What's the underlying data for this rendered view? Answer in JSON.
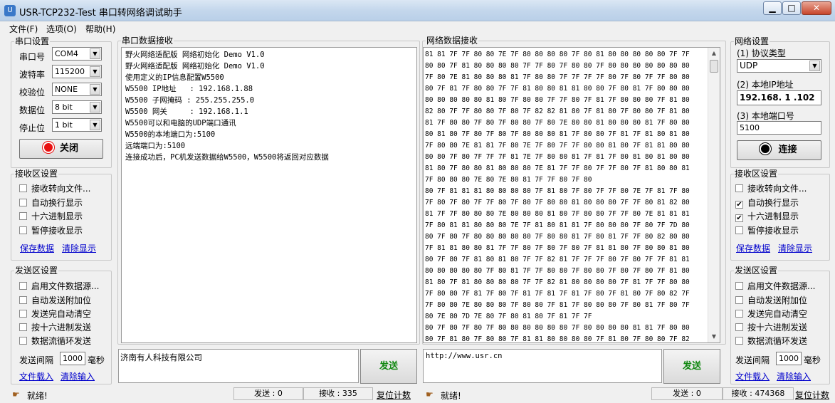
{
  "window": {
    "title": "USR-TCP232-Test 串口转网络调试助手",
    "minimize": "▁",
    "maximize": "□",
    "close": "✕"
  },
  "menu": [
    "文件(F)",
    "选项(O)",
    "帮助(H)"
  ],
  "serial": {
    "group": "串口设置",
    "port_label": "串口号",
    "port_value": "COM4",
    "baud_label": "波特率",
    "baud_value": "115200",
    "parity_label": "校验位",
    "parity_value": "NONE",
    "databits_label": "数据位",
    "databits_value": "8 bit",
    "stopbits_label": "停止位",
    "stopbits_value": "1 bit",
    "close_button": "关闭"
  },
  "serial_rx_settings": {
    "group": "接收区设置",
    "options": [
      {
        "label": "接收转向文件...",
        "checked": false
      },
      {
        "label": "自动换行显示",
        "checked": false
      },
      {
        "label": "十六进制显示",
        "checked": false
      },
      {
        "label": "暂停接收显示",
        "checked": false
      }
    ],
    "save": "保存数据",
    "clear": "清除显示"
  },
  "serial_tx_settings": {
    "group": "发送区设置",
    "options": [
      {
        "label": "启用文件数据源...",
        "checked": false
      },
      {
        "label": "自动发送附加位",
        "checked": false
      },
      {
        "label": "发送完自动清空",
        "checked": false
      },
      {
        "label": "按十六进制发送",
        "checked": false
      },
      {
        "label": "数据流循环发送",
        "checked": false
      }
    ],
    "interval_label": "发送间隔",
    "interval_value": "1000",
    "interval_unit": "毫秒",
    "load": "文件载入",
    "clear": "清除输入"
  },
  "serial_rx": {
    "group": "串口数据接收",
    "lines": [
      "野火网络适配版 网络初始化 Demo V1.0",
      "野火网络适配版 网络初始化 Demo V1.0",
      "使用定义的IP信息配置W5500",
      "W5500 IP地址   : 192.168.1.88",
      "W5500 子网掩码 : 255.255.255.0",
      "W5500 网关     : 192.168.1.1",
      "W5500可以和电脑的UDP端口通讯",
      "W5500的本地端口为:5100",
      "远端端口为:5100",
      "连接成功后，PC机发送数据给W5500，W5500将返回对应数据"
    ]
  },
  "serial_tx_text": "济南有人科技有限公司",
  "serial_send_button": "发送",
  "net_rx": {
    "group": "网络数据接收",
    "lines": [
      "81 81 7F 7F 80 80 7E 7F 80 80 80 80 7F 80 81 80 80 80 80 80 7F 7F",
      "80 80 7F 81 80 80 80 80 7F 7F 80 7F 80 80 7F 80 80 80 80 80 80 80",
      "7F 80 7E 81 80 80 80 81 7F 80 80 7F 7F 7F 7F 80 7F 80 7F 7F 80 80",
      "80 7F 81 7F 80 80 7F 7F 81 80 80 81 81 80 80 7F 80 81 7F 80 80 80",
      "80 80 80 80 80 81 80 7F 80 80 7F 7F 80 7F 81 7F 80 80 80 7F 81 80",
      "82 80 7F 7F 80 80 7F 80 7F 82 82 81 80 7F 81 80 7F 80 80 7F 81 80",
      "81 7F 80 80 7F 80 7F 80 80 7F 80 7E 80 80 81 80 80 80 81 7F 80 80",
      "80 81 80 7F 80 7F 80 7F 80 80 80 81 7F 80 80 7F 81 7F 81 80 81 80",
      "7F 80 80 7E 81 81 7F 80 7E 7F 80 7F 7F 80 80 81 80 7F 81 81 80 80",
      "80 80 7F 80 7F 7F 7F 81 7E 7F 80 80 81 7F 81 7F 80 81 80 81 80 80",
      "81 80 7F 80 80 81 80 80 80 7E 81 7F 7F 80 7F 7F 80 7F 81 80 80 81",
      "7F 80 80 80 7E 80 7E 80 81 7F 7F 80 7F 80",
      "80 7F 81 81 81 80 80 80 80 7F 81 80 7F 80 7F 7F 80 7E 7F 81 7F 80",
      "7F 80 7F 80 7F 7F 80 7F 80 7F 80 80 81 80 80 80 7F 7F 80 81 82 80",
      "81 7F 7F 80 80 80 7E 80 80 80 81 80 7F 80 80 7F 7F 80 7E 81 81 81",
      "7F 80 81 81 80 80 80 7E 7F 81 80 81 81 7F 80 80 80 7F 80 7F 7D 80",
      "80 7F 80 7F 80 80 80 80 80 7F 80 80 81 7F 80 81 7F 7F 80 82 80 80",
      "7F 81 81 80 80 81 7F 7F 80 7F 80 7F 80 7F 81 81 80 7F 80 80 81 80",
      "80 7F 80 7F 81 80 81 80 7F 7F 82 81 7F 7F 7F 80 7F 80 7F 7F 81 81",
      "80 80 80 80 80 7F 80 81 7F 7F 80 80 7F 80 80 7F 80 7F 80 7F 81 80",
      "81 80 7F 81 80 80 80 80 7F 7F 82 81 80 80 80 80 7F 81 7F 7F 80 80",
      "7F 80 80 7F 81 7F 80 7F 81 7F 81 7F 81 7F 80 7F 81 80 7F 80 82 7F",
      "7F 80 80 7E 80 80 80 7F 80 80 7F 81 7F 80 80 80 7F 80 81 7F 80 7F",
      "80 7E 80 7D 7E 80 7F 80 81 80 7F 81 7F 7F",
      "80 7F 80 7F 80 7F 80 80 80 80 80 80 7F 80 80 80 80 81 81 7F 80 80",
      "80 7F 81 80 7F 80 80 7F 81 81 80 80 80 80 7F 81 80 7F 80 80 7F 82"
    ]
  },
  "net_tx_text": "http://www.usr.cn",
  "net_send_button": "发送",
  "network": {
    "group": "网络设置",
    "proto_label": "(1) 协议类型",
    "proto_value": "UDP",
    "ip_label": "(2) 本地IP地址",
    "ip_value": "192.168. 1 .102",
    "port_label": "(3) 本地端口号",
    "port_value": "5100",
    "connect_button": "连接"
  },
  "net_rx_settings": {
    "group": "接收区设置",
    "options": [
      {
        "label": "接收转向文件...",
        "checked": false
      },
      {
        "label": "自动换行显示",
        "checked": true
      },
      {
        "label": "十六进制显示",
        "checked": true
      },
      {
        "label": "暂停接收显示",
        "checked": false
      }
    ],
    "save": "保存数据",
    "clear": "清除显示"
  },
  "net_tx_settings": {
    "group": "发送区设置",
    "options": [
      {
        "label": "启用文件数据源...",
        "checked": false
      },
      {
        "label": "自动发送附加位",
        "checked": false
      },
      {
        "label": "发送完自动清空",
        "checked": false
      },
      {
        "label": "按十六进制发送",
        "checked": false
      },
      {
        "label": "数据流循环发送",
        "checked": false
      }
    ],
    "interval_label": "发送间隔",
    "interval_value": "1000",
    "interval_unit": "毫秒",
    "load": "文件载入",
    "clear": "清除输入"
  },
  "status_left": {
    "state": "就绪!",
    "sent": "发送 : 0",
    "received": "接收 : 335",
    "reset": "复位计数"
  },
  "status_right": {
    "state": "就绪!",
    "sent": "发送 : 0",
    "received": "接收 : 474368",
    "reset": "复位计数"
  }
}
